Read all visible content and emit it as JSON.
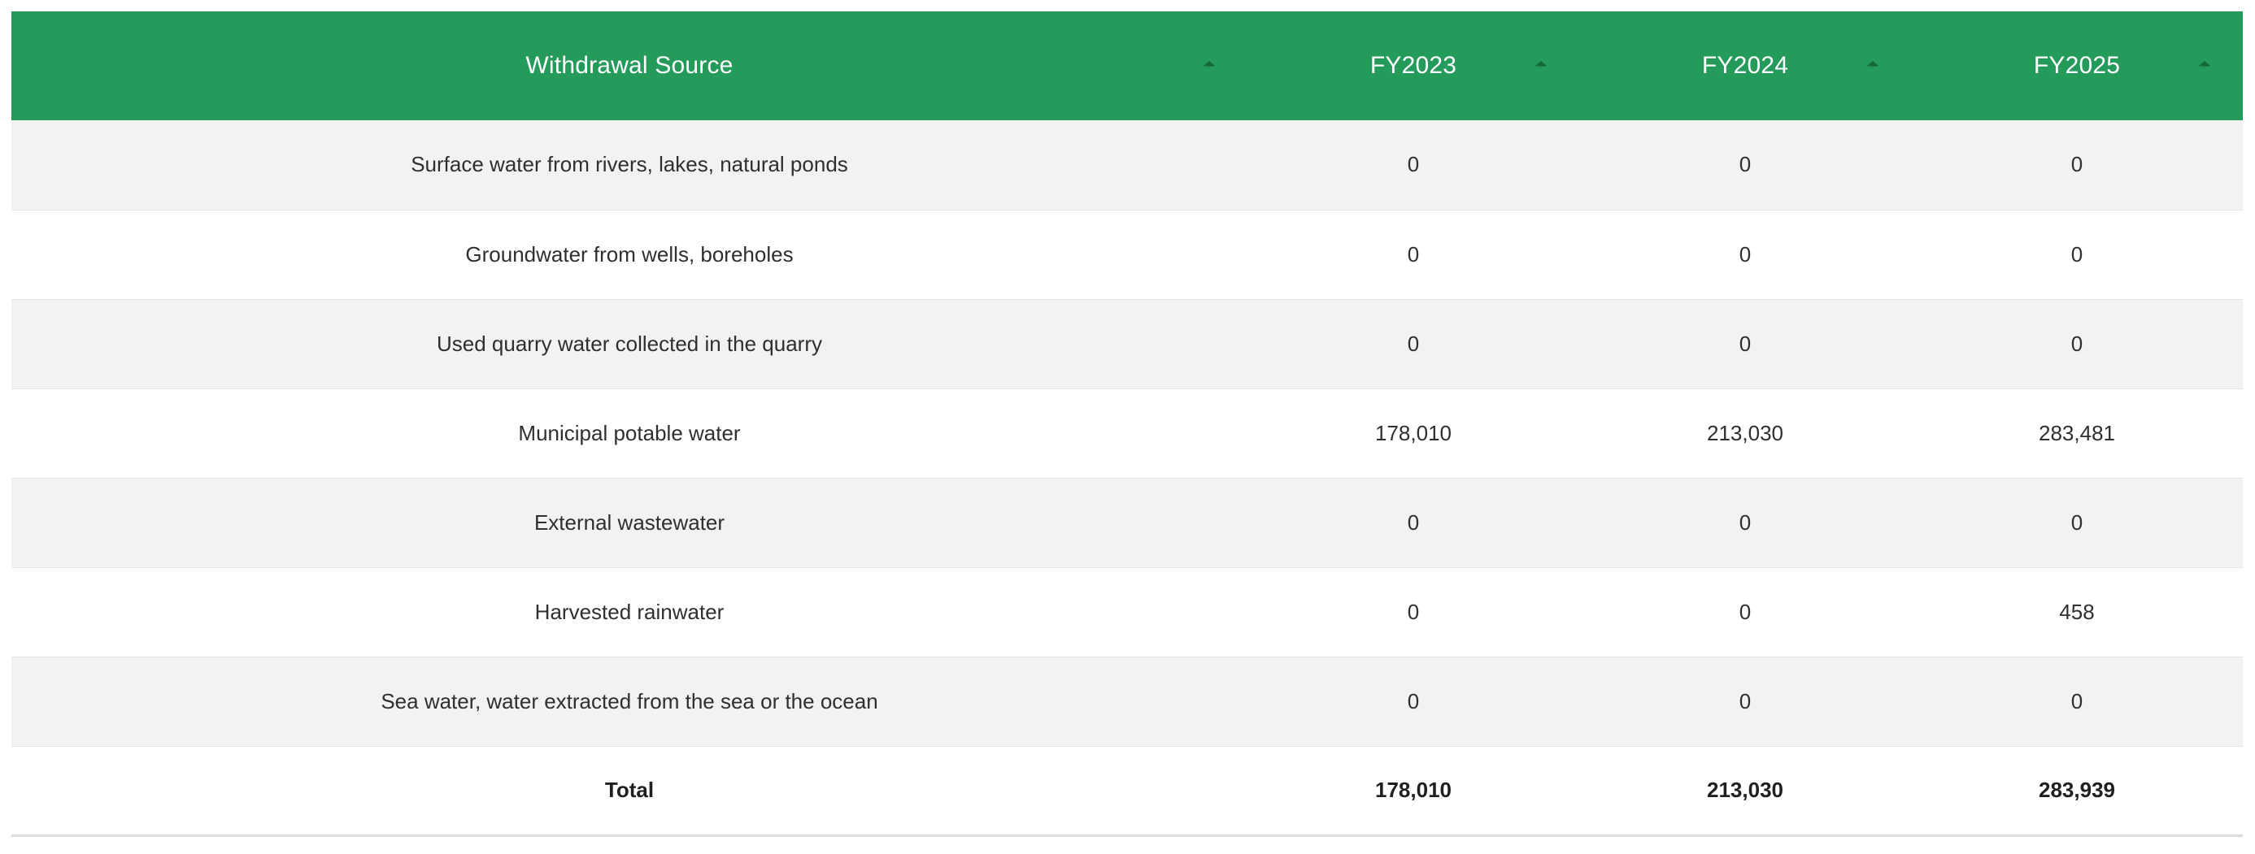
{
  "table": {
    "headers": {
      "source": "Withdrawal Source",
      "fy2023": "FY2023",
      "fy2024": "FY2024",
      "fy2025": "FY2025"
    },
    "rows": [
      {
        "source": "Surface water from rivers, lakes, natural ponds",
        "fy2023": "0",
        "fy2024": "0",
        "fy2025": "0"
      },
      {
        "source": "Groundwater from wells, boreholes",
        "fy2023": "0",
        "fy2024": "0",
        "fy2025": "0"
      },
      {
        "source": "Used quarry water collected in the quarry",
        "fy2023": "0",
        "fy2024": "0",
        "fy2025": "0"
      },
      {
        "source": "Municipal potable water",
        "fy2023": "178,010",
        "fy2024": "213,030",
        "fy2025": "283,481"
      },
      {
        "source": "External wastewater",
        "fy2023": "0",
        "fy2024": "0",
        "fy2025": "0"
      },
      {
        "source": "Harvested rainwater",
        "fy2023": "0",
        "fy2024": "0",
        "fy2025": "458"
      },
      {
        "source": "Sea water, water extracted from the sea or the ocean",
        "fy2023": "0",
        "fy2024": "0",
        "fy2025": "0"
      }
    ],
    "total": {
      "source": "Total",
      "fy2023": "178,010",
      "fy2024": "213,030",
      "fy2025": "283,939"
    }
  },
  "colors": {
    "header_bg": "#249a5b",
    "header_text": "#ffffff",
    "stripe_bg": "#f2f2f2"
  },
  "icons": {
    "sort": "sort-icon"
  }
}
